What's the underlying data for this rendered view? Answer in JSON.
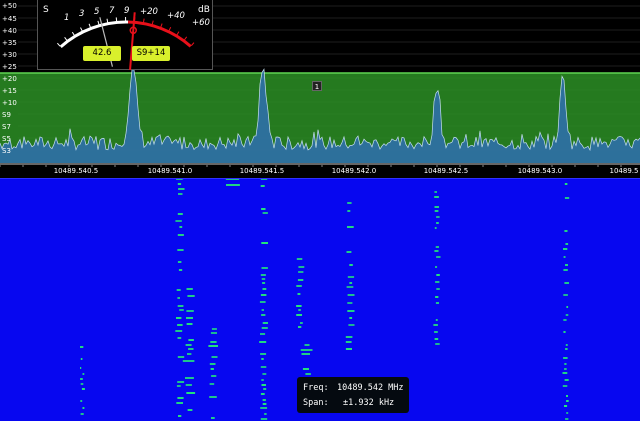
{
  "app": "SDR receiver",
  "smeter": {
    "s_label": "S",
    "db_label": "dB",
    "scale_s": [
      "1",
      "3",
      "5",
      "7",
      "9"
    ],
    "scale_db": [
      "+20",
      "+40",
      "+60"
    ],
    "level_value": "42.6",
    "s_reading": "S9+14",
    "needle_color": "#e8101a",
    "badge_color": "#d9f02c"
  },
  "spectrum": {
    "db_scale": [
      "+50",
      "+45",
      "+40",
      "+35",
      "+30",
      "+25",
      "+20",
      "+15",
      "+10",
      "S9",
      "S7",
      "S5",
      "S3"
    ],
    "freq_labels": [
      "10489.540.5",
      "10489.541.0",
      "10489.541.5",
      "10489.542.0",
      "10489.542.5",
      "10489.543.0",
      "10489.5"
    ],
    "marker_label": "1",
    "passband_color": "#2b8f25",
    "trace_color": "#2f6fa8"
  },
  "waterfall": {
    "background_color": "#0707f0",
    "signal_color": "#22e87a"
  },
  "info": {
    "freq_label": "Freq:",
    "freq_value": "10489.542 MHz",
    "span_label": "Span:",
    "span_value": "±1.932 kHz"
  }
}
